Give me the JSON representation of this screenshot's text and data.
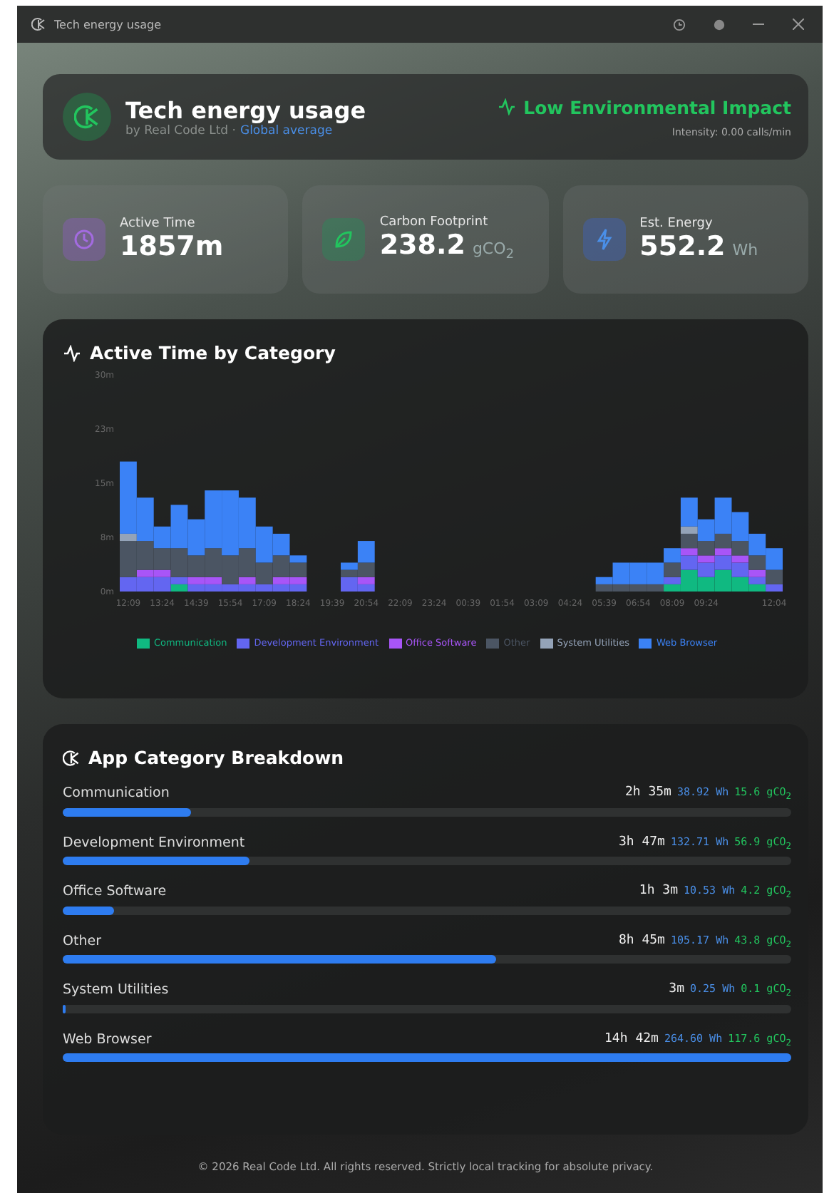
{
  "window": {
    "title": "Tech energy usage"
  },
  "header": {
    "title": "Tech energy usage",
    "byline": "by Real Code Ltd ·",
    "link": "Global average",
    "status": "Low Environmental Impact",
    "intensity": "Intensity: 0.00 calls/min"
  },
  "stats": [
    {
      "kind": "time",
      "label": "Active Time",
      "value": "1857m"
    },
    {
      "kind": "carbon",
      "label": "Carbon Footprint",
      "value": "238.2",
      "unit": "gCO$_{2}$"
    },
    {
      "kind": "energy",
      "label": "Est. Energy",
      "value": "552.2",
      "unit": "Wh"
    }
  ],
  "chart": {
    "title": "Active Time by Category",
    "chart_data": {
      "type": "bar",
      "stacked": true,
      "legend": "bottom",
      "categories": [
        "12:09",
        null,
        "13:24",
        null,
        "14:39",
        null,
        "15:54",
        null,
        "17:09",
        null,
        "18:24",
        null,
        "19:39",
        null,
        "20:54",
        null,
        "22:09",
        null,
        "23:24",
        null,
        "00:39",
        null,
        "01:54",
        null,
        "03:09",
        null,
        "04:24",
        null,
        "05:39",
        null,
        "06:54",
        null,
        "08:09",
        null,
        "09:24",
        null,
        null,
        null,
        "12:04"
      ],
      "series": [
        {
          "name": "Communication",
          "color": "#10b981",
          "values": [
            0,
            0,
            0,
            1,
            0,
            0,
            0,
            0,
            0,
            0,
            0,
            0,
            0,
            0,
            0,
            0,
            0,
            0,
            0,
            0,
            0,
            0,
            0,
            0,
            0,
            0,
            0,
            0,
            0,
            0,
            0,
            0,
            1,
            3,
            2,
            3,
            2,
            1,
            0
          ]
        },
        {
          "name": "Development Environment",
          "color": "#6366f1",
          "values": [
            2,
            2,
            2,
            1,
            1,
            1,
            1,
            1,
            1,
            1,
            1,
            0,
            0,
            2,
            1,
            0,
            0,
            0,
            0,
            0,
            0,
            0,
            0,
            0,
            0,
            0,
            0,
            0,
            0,
            0,
            0,
            0,
            1,
            2,
            2,
            2,
            2,
            1,
            1
          ]
        },
        {
          "name": "Office Software",
          "color": "#a855f7",
          "values": [
            0,
            1,
            1,
            0,
            1,
            1,
            0,
            1,
            0,
            1,
            1,
            0,
            0,
            0,
            1,
            0,
            0,
            0,
            0,
            0,
            0,
            0,
            0,
            0,
            0,
            0,
            0,
            0,
            0,
            0,
            0,
            0,
            0,
            1,
            1,
            1,
            1,
            1,
            0
          ]
        },
        {
          "name": "Other",
          "color": "#4b5563",
          "values": [
            5,
            4,
            3,
            4,
            3,
            4,
            4,
            4,
            3,
            3,
            2,
            0,
            0,
            1,
            2,
            0,
            0,
            0,
            0,
            0,
            0,
            0,
            0,
            0,
            0,
            0,
            0,
            0,
            1,
            1,
            1,
            1,
            2,
            2,
            2,
            2,
            2,
            2,
            2
          ]
        },
        {
          "name": "System Utilities",
          "color": "#94a3b8",
          "values": [
            1,
            0,
            0,
            0,
            0,
            0,
            0,
            0,
            0,
            0,
            0,
            0,
            0,
            0,
            0,
            0,
            0,
            0,
            0,
            0,
            0,
            0,
            0,
            0,
            0,
            0,
            0,
            0,
            0,
            0,
            0,
            0,
            0,
            1,
            0,
            0,
            0,
            0,
            0
          ]
        },
        {
          "name": "Web Browser",
          "color": "#3b82f6",
          "values": [
            10,
            6,
            3,
            6,
            5,
            8,
            9,
            7,
            5,
            3,
            1,
            0,
            0,
            1,
            3,
            0,
            0,
            0,
            0,
            0,
            0,
            0,
            0,
            0,
            0,
            0,
            0,
            0,
            1,
            3,
            3,
            3,
            2,
            4,
            3,
            5,
            4,
            3,
            3
          ]
        }
      ],
      "ylim": [
        0,
        30
      ],
      "yticks": [
        {
          "value": 0,
          "label": "0m"
        },
        {
          "value": 7.5,
          "label": "8m"
        },
        {
          "value": 15,
          "label": "15m"
        },
        {
          "value": 22.5,
          "label": "23m"
        },
        {
          "value": 30,
          "label": "30m"
        }
      ]
    }
  },
  "breakdown": {
    "title": "App Category Breakdown",
    "items": [
      {
        "name": "Communication",
        "time": "2h 35m",
        "energy": "38.92 Wh",
        "carbon": "15.6 gCO$_{2}$",
        "level": 0.176
      },
      {
        "name": "Development Environment",
        "time": "3h 47m",
        "energy": "132.71 Wh",
        "carbon": "56.9 gCO$_{2}$",
        "level": 0.257
      },
      {
        "name": "Office Software",
        "time": "1h 3m",
        "energy": "10.53 Wh",
        "carbon": "4.2 gCO$_{2}$",
        "level": 0.071
      },
      {
        "name": "Other",
        "time": "8h 45m",
        "energy": "105.17 Wh",
        "carbon": "43.8 gCO$_{2}$",
        "level": 0.595
      },
      {
        "name": "System Utilities",
        "time": "3m",
        "energy": "0.25 Wh",
        "carbon": "0.1 gCO$_{2}$",
        "level": 0.003
      },
      {
        "name": "Web Browser",
        "time": "14h 42m",
        "energy": "264.60 Wh",
        "carbon": "117.6 gCO$_{2}$",
        "level": 1
      }
    ]
  },
  "footer": "© 2026 Real Code Ltd. All rights reserved. Strictly local tracking for absolute privacy."
}
